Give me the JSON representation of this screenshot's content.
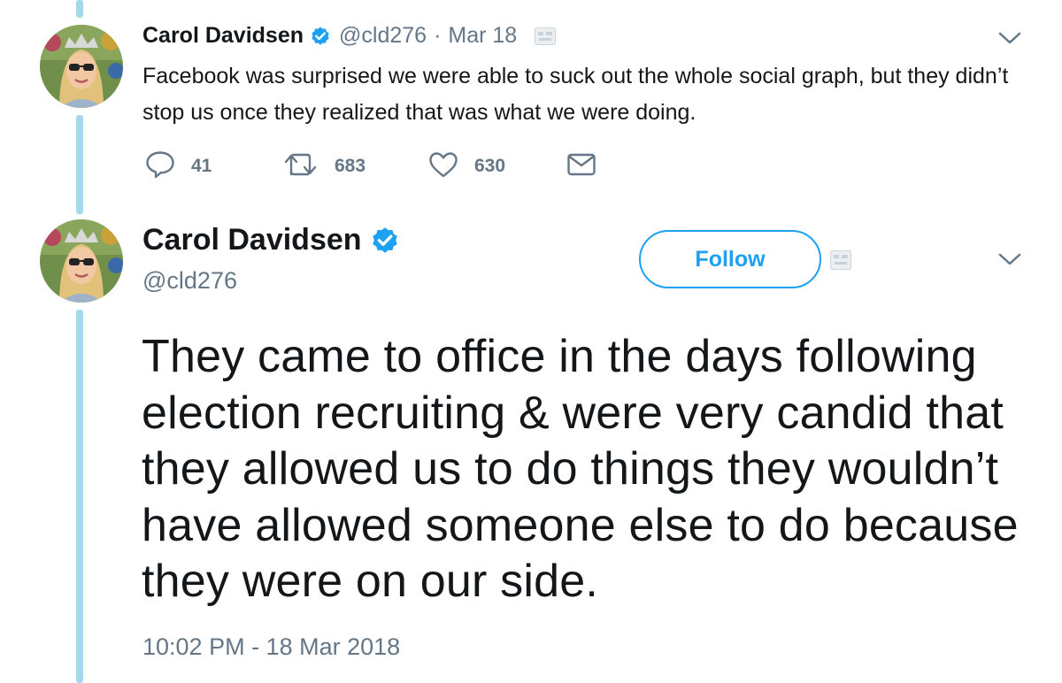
{
  "tweet1": {
    "name": "Carol Davidsen",
    "handle": "@cld276",
    "separator": "·",
    "date": "Mar 18",
    "text": "Facebook was surprised we were able to suck out the whole social graph, but they didn’t stop us once they realized that was what we were doing.",
    "replies": "41",
    "retweets": "683",
    "likes": "630",
    "icons": [
      "verified-badge-icon",
      "translate-icon",
      "chevron-down-icon",
      "reply-icon",
      "retweet-icon",
      "heart-icon",
      "envelope-icon"
    ]
  },
  "tweet2": {
    "name": "Carol Davidsen",
    "handle": "@cld276",
    "follow_label": "Follow",
    "text": "They came to office in the days following election recruiting &  were very candid that they allowed us to do things they wouldn’t have allowed someone else to do because they were on our side.",
    "timestamp": "10:02 PM - 18 Mar 2018"
  },
  "colors": {
    "accent": "#1da1f2",
    "thread_line": "#a4d8ec",
    "secondary_text": "#657786",
    "primary_text": "#14171a"
  }
}
